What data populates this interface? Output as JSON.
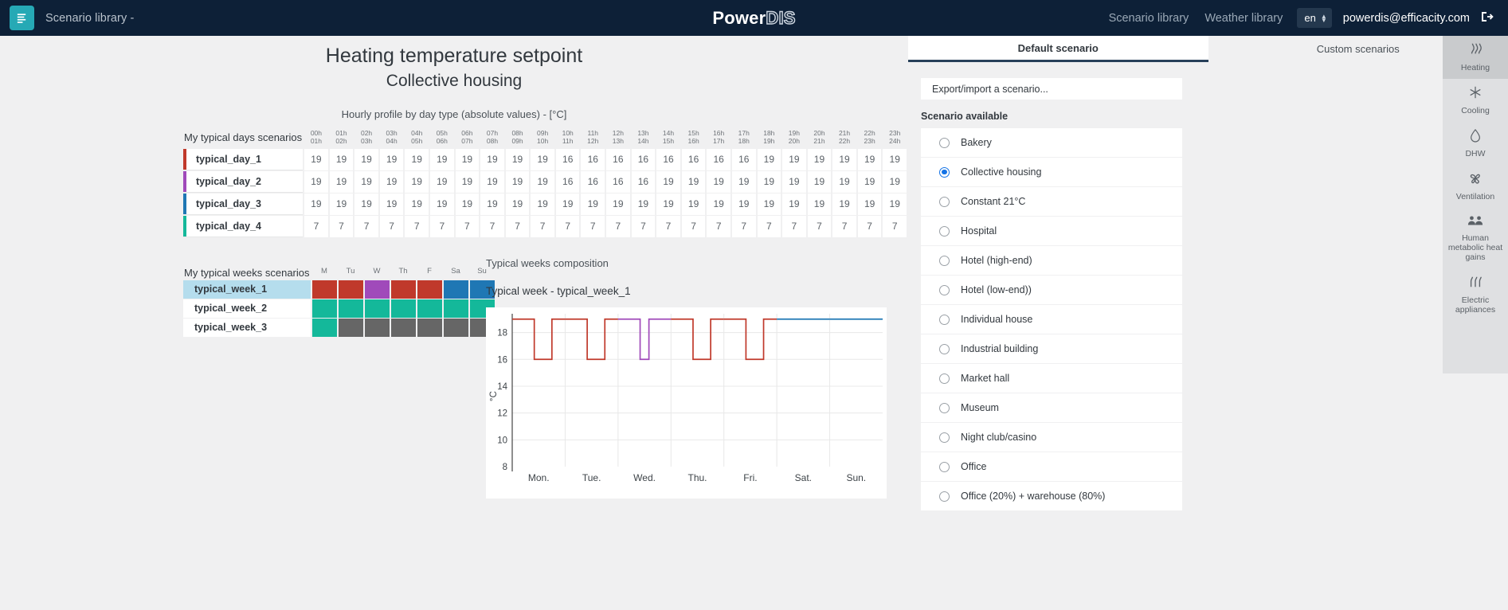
{
  "topbar": {
    "menu_icon": "hamburger-icon",
    "left_title": "Scenario library -",
    "logo_part1": "Power",
    "logo_part2": "DIS",
    "link_scenario_library": "Scenario library",
    "link_weather_library": "Weather library",
    "language": "en",
    "user_email": "powerdis@efficacity.com",
    "logout_icon": "logout-icon",
    "bg_color": "#0d2037",
    "accent_color": "#26a9b5"
  },
  "page": {
    "title": "Heating temperature setpoint",
    "subtitle": "Collective housing"
  },
  "hourly": {
    "caption": "Hourly profile by day type (absolute values) - [°C]",
    "row_header_label": "My typical days scenarios",
    "hour_from": [
      "00h",
      "01h",
      "02h",
      "03h",
      "04h",
      "05h",
      "06h",
      "07h",
      "08h",
      "09h",
      "10h",
      "11h",
      "12h",
      "13h",
      "14h",
      "15h",
      "16h",
      "17h",
      "18h",
      "19h",
      "20h",
      "21h",
      "22h",
      "23h"
    ],
    "hour_to": [
      "01h",
      "02h",
      "03h",
      "04h",
      "05h",
      "06h",
      "07h",
      "08h",
      "09h",
      "10h",
      "11h",
      "12h",
      "13h",
      "14h",
      "15h",
      "16h",
      "17h",
      "18h",
      "19h",
      "20h",
      "21h",
      "22h",
      "23h",
      "24h"
    ],
    "rows": [
      {
        "name": "typical_day_1",
        "color": "#c0392b",
        "values": [
          19,
          19,
          19,
          19,
          19,
          19,
          19,
          19,
          19,
          19,
          16,
          16,
          16,
          16,
          16,
          16,
          16,
          16,
          19,
          19,
          19,
          19,
          19,
          19
        ]
      },
      {
        "name": "typical_day_2",
        "color": "#a04aba",
        "values": [
          19,
          19,
          19,
          19,
          19,
          19,
          19,
          19,
          19,
          19,
          16,
          16,
          16,
          16,
          19,
          19,
          19,
          19,
          19,
          19,
          19,
          19,
          19,
          19
        ]
      },
      {
        "name": "typical_day_3",
        "color": "#1f77b4",
        "values": [
          19,
          19,
          19,
          19,
          19,
          19,
          19,
          19,
          19,
          19,
          19,
          19,
          19,
          19,
          19,
          19,
          19,
          19,
          19,
          19,
          19,
          19,
          19,
          19
        ]
      },
      {
        "name": "typical_day_4",
        "color": "#14b89a",
        "values": [
          7,
          7,
          7,
          7,
          7,
          7,
          7,
          7,
          7,
          7,
          7,
          7,
          7,
          7,
          7,
          7,
          7,
          7,
          7,
          7,
          7,
          7,
          7,
          7
        ]
      }
    ]
  },
  "weeks": {
    "row_header_label": "My typical weeks scenarios",
    "day_headers": [
      "M",
      "Tu",
      "W",
      "Th",
      "F",
      "Sa",
      "Su"
    ],
    "rows": [
      {
        "name": "typical_week_1",
        "selected": true,
        "colors": [
          "#c0392b",
          "#c0392b",
          "#a04aba",
          "#c0392b",
          "#c0392b",
          "#1f77b4",
          "#1f77b4"
        ]
      },
      {
        "name": "typical_week_2",
        "selected": false,
        "colors": [
          "#14b89a",
          "#14b89a",
          "#14b89a",
          "#14b89a",
          "#14b89a",
          "#14b89a",
          "#14b89a"
        ]
      },
      {
        "name": "typical_week_3",
        "selected": false,
        "colors": [
          "#14b89a",
          "#666666",
          "#666666",
          "#666666",
          "#666666",
          "#666666",
          "#666666"
        ]
      }
    ]
  },
  "chart_data": {
    "type": "line",
    "title": "Typical week - typical_week_1",
    "section_caption": "Typical weeks composition",
    "xlabel": "",
    "ylabel": "°C",
    "ylim": [
      8,
      19.4
    ],
    "yticks": [
      8,
      10,
      12,
      14,
      16,
      18
    ],
    "grid": true,
    "legend": "none",
    "categories": [
      "Mon.",
      "Tue.",
      "Wed.",
      "Thu.",
      "Fri.",
      "Sat.",
      "Sun."
    ],
    "x": [
      0,
      1,
      2,
      3,
      4,
      5,
      6,
      7,
      8,
      9,
      10,
      11,
      12,
      13,
      14,
      15,
      16,
      17,
      18,
      19,
      20,
      21,
      22,
      23,
      24,
      25,
      26,
      27,
      28,
      29,
      30,
      31,
      32,
      33,
      34,
      35,
      36,
      37,
      38,
      39,
      40,
      41,
      42,
      43,
      44,
      45,
      46,
      47,
      48,
      49,
      50,
      51,
      52,
      53,
      54,
      55,
      56,
      57,
      58,
      59,
      60,
      61,
      62,
      63,
      64,
      65,
      66,
      67,
      68,
      69,
      70,
      71,
      72,
      73,
      74,
      75,
      76,
      77,
      78,
      79,
      80,
      81,
      82,
      83,
      84,
      85,
      86,
      87,
      88,
      89,
      90,
      91,
      92,
      93,
      94,
      95,
      96,
      97,
      98,
      99,
      100,
      101,
      102,
      103,
      104,
      105,
      106,
      107,
      108,
      109,
      110,
      111,
      112,
      113,
      114,
      115,
      116,
      117,
      118,
      119,
      120,
      121,
      122,
      123,
      124,
      125,
      126,
      127,
      128,
      129,
      130,
      131,
      132,
      133,
      134,
      135,
      136,
      137,
      138,
      139,
      140,
      141,
      142,
      143,
      144,
      145,
      146,
      147,
      148,
      149,
      150,
      151,
      152,
      153,
      154,
      155,
      156,
      157,
      158,
      159,
      160,
      161,
      162,
      163,
      164,
      165,
      166,
      167
    ],
    "series": [
      {
        "name": "Mon. (typical_day_1)",
        "color": "#c0392b",
        "day": "Mon.",
        "values": [
          19,
          19,
          19,
          19,
          19,
          19,
          19,
          19,
          19,
          19,
          16,
          16,
          16,
          16,
          16,
          16,
          16,
          16,
          19,
          19,
          19,
          19,
          19,
          19
        ]
      },
      {
        "name": "Tue. (typical_day_1)",
        "color": "#c0392b",
        "day": "Tue.",
        "values": [
          19,
          19,
          19,
          19,
          19,
          19,
          19,
          19,
          19,
          19,
          16,
          16,
          16,
          16,
          16,
          16,
          16,
          16,
          19,
          19,
          19,
          19,
          19,
          19
        ]
      },
      {
        "name": "Wed. (typical_day_2)",
        "color": "#a04aba",
        "day": "Wed.",
        "values": [
          19,
          19,
          19,
          19,
          19,
          19,
          19,
          19,
          19,
          19,
          16,
          16,
          16,
          16,
          19,
          19,
          19,
          19,
          19,
          19,
          19,
          19,
          19,
          19
        ]
      },
      {
        "name": "Thu. (typical_day_1)",
        "color": "#c0392b",
        "day": "Thu.",
        "values": [
          19,
          19,
          19,
          19,
          19,
          19,
          19,
          19,
          19,
          19,
          16,
          16,
          16,
          16,
          16,
          16,
          16,
          16,
          19,
          19,
          19,
          19,
          19,
          19
        ]
      },
      {
        "name": "Fri. (typical_day_1)",
        "color": "#c0392b",
        "day": "Fri.",
        "values": [
          19,
          19,
          19,
          19,
          19,
          19,
          19,
          19,
          19,
          19,
          16,
          16,
          16,
          16,
          16,
          16,
          16,
          16,
          19,
          19,
          19,
          19,
          19,
          19
        ]
      },
      {
        "name": "Sat. (typical_day_3)",
        "color": "#1f77b4",
        "day": "Sat.",
        "values": [
          19,
          19,
          19,
          19,
          19,
          19,
          19,
          19,
          19,
          19,
          19,
          19,
          19,
          19,
          19,
          19,
          19,
          19,
          19,
          19,
          19,
          19,
          19,
          19
        ]
      },
      {
        "name": "Sun. (typical_day_3)",
        "color": "#1f77b4",
        "day": "Sun.",
        "values": [
          19,
          19,
          19,
          19,
          19,
          19,
          19,
          19,
          19,
          19,
          19,
          19,
          19,
          19,
          19,
          19,
          19,
          19,
          19,
          19,
          19,
          19,
          19,
          19
        ]
      }
    ]
  },
  "right_panel": {
    "tabs": [
      {
        "label": "Default scenario",
        "active": true
      },
      {
        "label": "Custom scenarios",
        "active": false
      }
    ],
    "export_import_label": "Export/import a scenario...",
    "available_label": "Scenario available",
    "scenarios": [
      {
        "label": "Bakery",
        "selected": false
      },
      {
        "label": "Collective housing",
        "selected": true
      },
      {
        "label": "Constant 21°C",
        "selected": false
      },
      {
        "label": "Hospital",
        "selected": false
      },
      {
        "label": "Hotel (high-end)",
        "selected": false
      },
      {
        "label": "Hotel (low-end))",
        "selected": false
      },
      {
        "label": "Individual house",
        "selected": false
      },
      {
        "label": "Industrial building",
        "selected": false
      },
      {
        "label": "Market hall",
        "selected": false
      },
      {
        "label": "Museum",
        "selected": false
      },
      {
        "label": "Night club/casino",
        "selected": false
      },
      {
        "label": "Office",
        "selected": false
      },
      {
        "label": "Office (20&#37) + warehouse (80&#37)",
        "selected": false
      }
    ]
  },
  "rail": {
    "items": [
      {
        "label": "Heating",
        "icon": "heating-icon",
        "glyph": "≋",
        "active": true
      },
      {
        "label": "Cooling",
        "icon": "cooling-icon",
        "glyph": "✳",
        "active": false
      },
      {
        "label": "DHW",
        "icon": "dhw-droplet-icon",
        "glyph": "◊",
        "active": false
      },
      {
        "label": "Ventilation",
        "icon": "ventilation-fan-icon",
        "glyph": "✼",
        "active": false
      },
      {
        "label": "Human metabolic heat gains",
        "icon": "people-icon",
        "glyph": "👥",
        "active": false
      },
      {
        "label": "Electric appliances",
        "icon": "appliances-icon",
        "glyph": "〽",
        "active": false
      }
    ]
  }
}
